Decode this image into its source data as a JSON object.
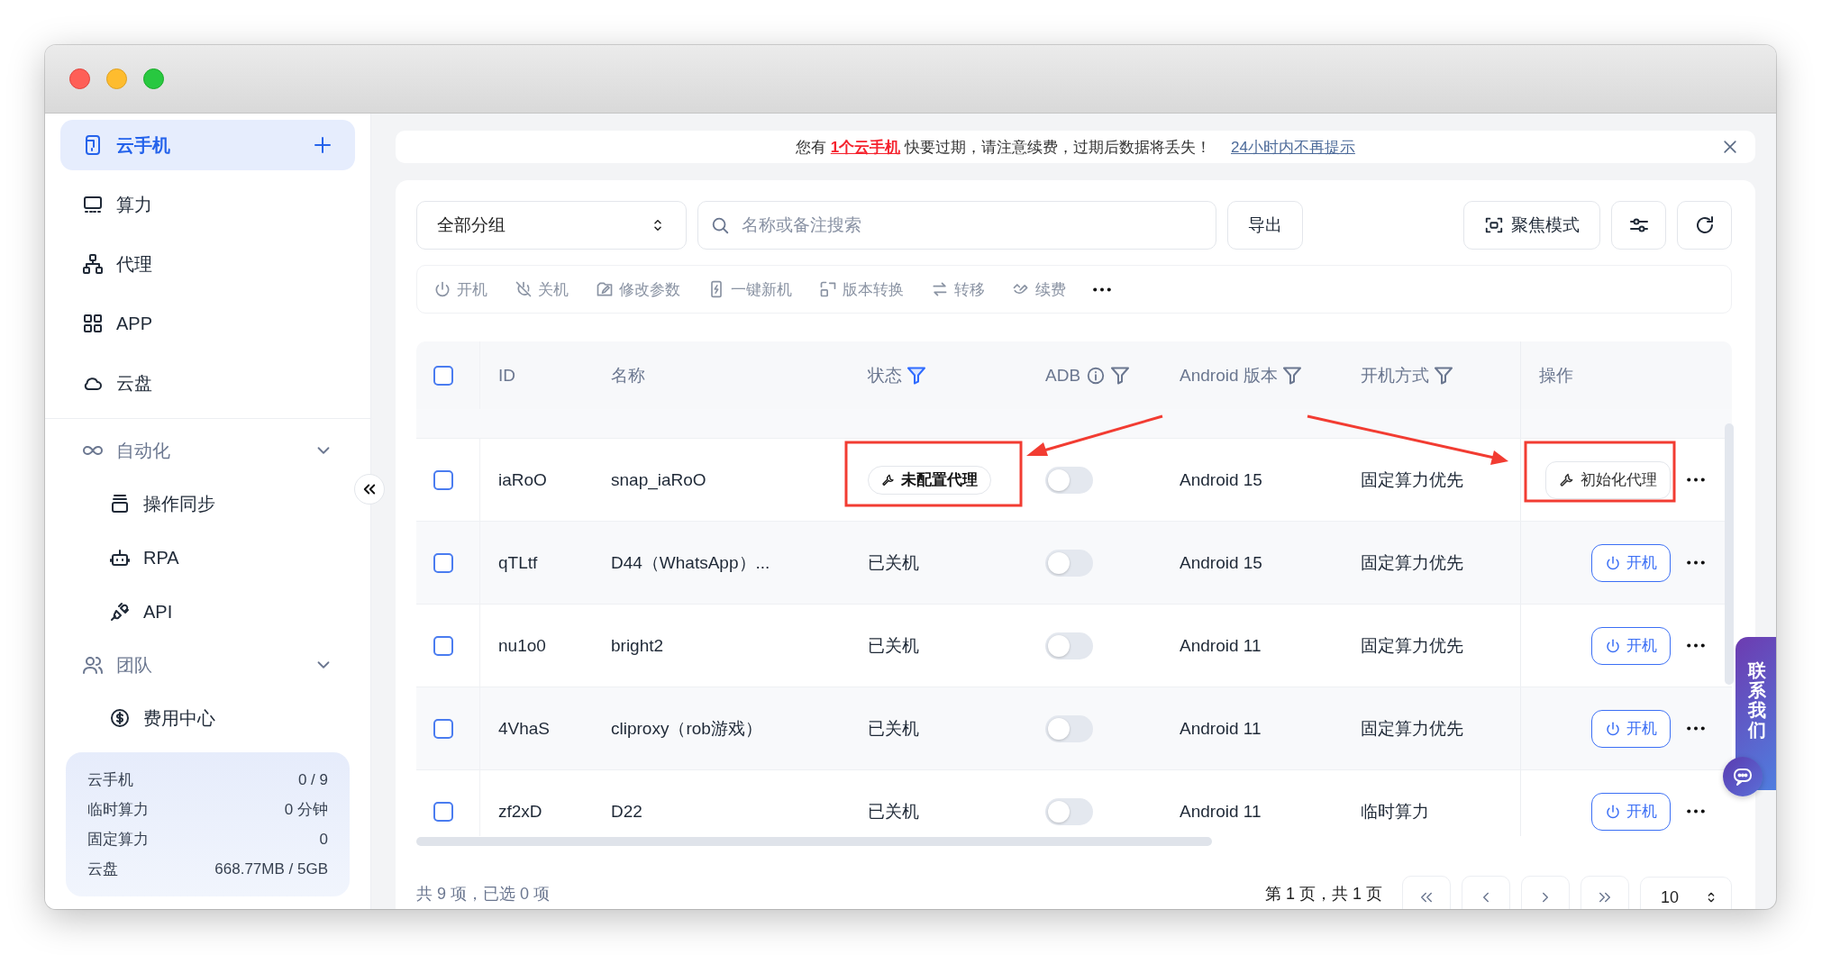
{
  "sidebar": {
    "items": [
      {
        "kind": "item",
        "label": "云手机",
        "selected": true
      },
      {
        "kind": "item",
        "label": "算力",
        "selected": false
      },
      {
        "kind": "item",
        "label": "代理",
        "selected": false
      },
      {
        "kind": "item",
        "label": "APP",
        "selected": false
      },
      {
        "kind": "item",
        "label": "云盘",
        "selected": false
      },
      {
        "kind": "group",
        "label": "自动化",
        "expanded": true,
        "children": [
          {
            "label": "操作同步",
            "selected": false
          },
          {
            "label": "RPA",
            "selected": false
          },
          {
            "label": "API",
            "selected": false
          }
        ]
      },
      {
        "kind": "group",
        "label": "团队",
        "expanded": true,
        "children": [
          {
            "label": "费用中心",
            "selected": false
          }
        ]
      }
    ],
    "stats": [
      {
        "label": "云手机",
        "value": "0 / 9"
      },
      {
        "label": "临时算力",
        "value": "0 分钟"
      },
      {
        "label": "固定算力",
        "value": "0"
      },
      {
        "label": "云盘",
        "value": "668.77MB / 5GB"
      }
    ]
  },
  "banner": {
    "before": "您有 ",
    "highlight": "1个云手机",
    "after": " 快要过期，请注意续费，过期后数据将丢失！",
    "link": "24小时内不再提示"
  },
  "toolbar": {
    "group_select": "全部分组",
    "search": {
      "placeholder": "名称或备注搜索"
    },
    "export": "导出",
    "focus_mode": "聚焦模式"
  },
  "actions": [
    {
      "kind": "power",
      "label": "开机",
      "disabled": true
    },
    {
      "kind": "power-off",
      "label": "关机",
      "disabled": true
    },
    {
      "kind": "edit",
      "label": "修改参数",
      "disabled": true
    },
    {
      "kind": "new",
      "label": "一键新机",
      "disabled": true
    },
    {
      "kind": "convert",
      "label": "版本转换",
      "disabled": true
    },
    {
      "kind": "transfer",
      "label": "转移",
      "disabled": true
    },
    {
      "kind": "renew",
      "label": "续费",
      "disabled": true
    }
  ],
  "table": {
    "all_checked": false,
    "columns": [
      {
        "label": "ID",
        "info": false,
        "filter": false
      },
      {
        "label": "名称",
        "info": false,
        "filter": false
      },
      {
        "label": "状态",
        "info": false,
        "filter": true,
        "filter_active": true
      },
      {
        "label": "ADB",
        "info": true,
        "filter": true,
        "filter_active": false
      },
      {
        "label": "Android 版本",
        "info": false,
        "filter": true,
        "filter_active": false
      },
      {
        "label": "开机方式",
        "info": false,
        "filter": true,
        "filter_active": false
      },
      {
        "label": "操作",
        "info": false,
        "filter": false
      }
    ],
    "rows": [
      {
        "checked": false,
        "id": "iaRoO",
        "name": "snap_iaRoO",
        "status": {
          "kind": "tag",
          "text": "未配置代理"
        },
        "adb_on": false,
        "android": "Android 15",
        "boot_mode": "固定算力优先",
        "action": {
          "kind": "init",
          "label": "初始化代理"
        }
      },
      {
        "checked": false,
        "id": "qTLtf",
        "name": "D44（WhatsApp）...",
        "status": {
          "kind": "text",
          "text": "已关机"
        },
        "adb_on": false,
        "android": "Android 15",
        "boot_mode": "固定算力优先",
        "action": {
          "kind": "power",
          "label": "开机"
        }
      },
      {
        "checked": false,
        "id": "nu1o0",
        "name": "bright2",
        "status": {
          "kind": "text",
          "text": "已关机"
        },
        "adb_on": false,
        "android": "Android 11",
        "boot_mode": "固定算力优先",
        "action": {
          "kind": "power",
          "label": "开机"
        }
      },
      {
        "checked": false,
        "id": "4VhaS",
        "name": "cliproxy（rob游戏）",
        "status": {
          "kind": "text",
          "text": "已关机"
        },
        "adb_on": false,
        "android": "Android 11",
        "boot_mode": "固定算力优先",
        "action": {
          "kind": "power",
          "label": "开机"
        }
      },
      {
        "checked": false,
        "id": "zf2xD",
        "name": "D22",
        "status": {
          "kind": "text",
          "text": "已关机"
        },
        "adb_on": false,
        "android": "Android 11",
        "boot_mode": "临时算力",
        "action": {
          "kind": "power",
          "label": "开机"
        }
      }
    ]
  },
  "footer": {
    "summary": "共 9 项，已选 0 项",
    "page_info": "第 1 页，共 1 页",
    "page_size": "10"
  },
  "contact": {
    "label": "联系我们"
  }
}
